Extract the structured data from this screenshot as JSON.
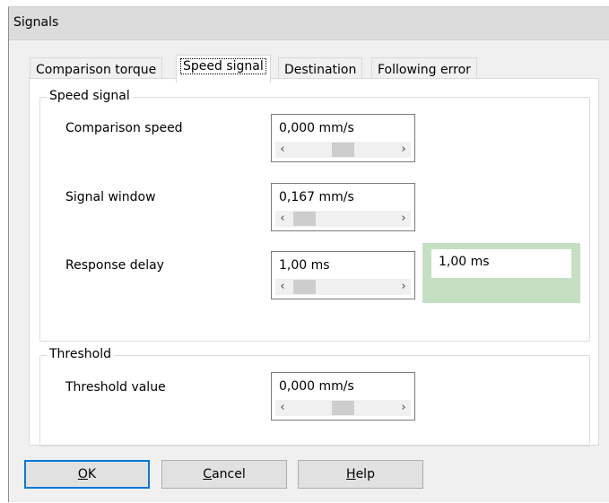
{
  "window": {
    "title": "Signals"
  },
  "tabs": [
    {
      "label": "Comparison torque",
      "active": false
    },
    {
      "label": "Speed signal",
      "active": true
    },
    {
      "label": "Destination",
      "active": false
    },
    {
      "label": "Following error",
      "active": false
    }
  ],
  "speed_signal_group": {
    "title": "Speed signal",
    "comparison_speed": {
      "label": "Comparison speed",
      "value": "0,000 mm/s",
      "slider_level": 0.5
    },
    "signal_window": {
      "label": "Signal window",
      "value": "0,167 mm/s",
      "slider_level": 0.12
    },
    "response_delay": {
      "label": "Response delay",
      "value": "1,00 ms",
      "slider_level": 0.1,
      "echo_value": "1,00 ms"
    }
  },
  "threshold_group": {
    "title": "Threshold",
    "threshold_value": {
      "label": "Threshold value",
      "value": "0,000 mm/s",
      "slider_level": 0.5
    }
  },
  "buttons": {
    "ok": {
      "mnemonic": "O",
      "rest": "K"
    },
    "cancel": {
      "mnemonic": "C",
      "rest": "ancel"
    },
    "help": {
      "mnemonic": "H",
      "rest": "elp"
    }
  },
  "colors": {
    "focus_border": "#0078d7",
    "echo_highlight": "#c5dfc3"
  },
  "icons": {
    "scroll_left": "‹",
    "scroll_right": "›"
  }
}
